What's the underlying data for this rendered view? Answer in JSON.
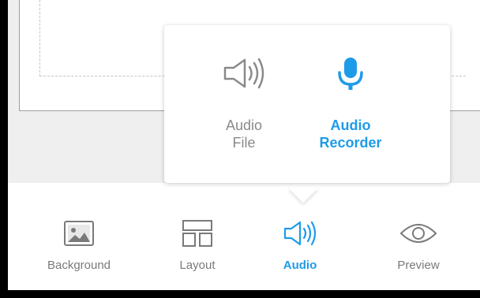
{
  "popover": {
    "options": [
      {
        "label_line1": "Audio",
        "label_line2": "File",
        "icon": "speaker-icon",
        "active": false
      },
      {
        "label_line1": "Audio",
        "label_line2": "Recorder",
        "icon": "microphone-icon",
        "active": true
      }
    ]
  },
  "toolbar": {
    "items": [
      {
        "label": "Background",
        "icon": "image-icon",
        "active": false
      },
      {
        "label": "Layout",
        "icon": "layout-icon",
        "active": false
      },
      {
        "label": "Audio",
        "icon": "speaker-icon",
        "active": true
      },
      {
        "label": "Preview",
        "icon": "eye-icon",
        "active": false
      }
    ]
  },
  "colors": {
    "accent": "#1e9be8",
    "inactive": "#8a8a8a",
    "canvas_background": "#efefef"
  }
}
